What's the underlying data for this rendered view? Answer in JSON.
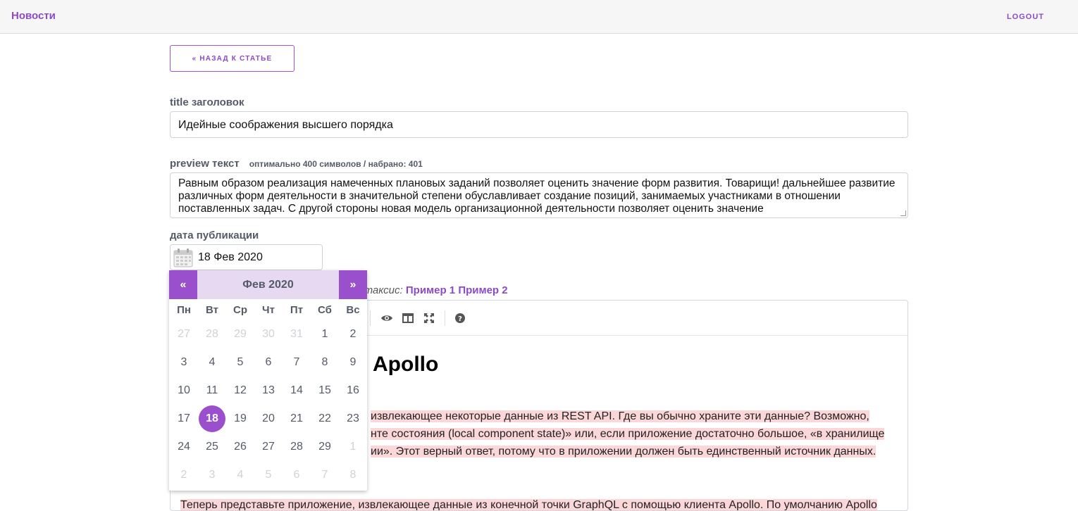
{
  "nav": {
    "brand": "Новости",
    "logout": "LOGOUT"
  },
  "back_button": "« НАЗАД К СТАТЬЕ",
  "title_field": {
    "label": "title заголовок",
    "value": "Идейные соображения высшего порядка"
  },
  "preview_field": {
    "label": "preview текст",
    "counter": "оптимально 400 символов / набрано: 401",
    "value": "Равным образом реализация намеченных плановых заданий позволяет оценить значение форм развития. Товарищи! дальнейшее развитие различных форм деятельности в значительной степени обуславливает создание позиций, занимаемых участниками в отношении поставленных задач. С другой стороны новая модель организационной деятельности позволяет оценить значение"
  },
  "date_field": {
    "label": "дата публикации",
    "value": "18 Фев 2020"
  },
  "syntax_hint": {
    "text": "интаксис:",
    "link1": "Пример 1",
    "link2": "Пример 2"
  },
  "toolbar_icons": [
    "eye-icon",
    "columns-icon",
    "fullscreen-icon",
    "help-icon"
  ],
  "editor": {
    "heading": "Apollo",
    "line1": "извлекающее некоторые данные из REST API. Где вы обычно храните эти данные? Возможно,",
    "line2": "нте состояния (local component state)» или, если приложение достаточно большое, «в хранилище",
    "line3": "ии». Этот верный ответ, потому что в приложении должен быть единственный источник данных.",
    "line4": "Теперь представьте приложение, извлекающее данные из конечной точки GraphQL с помощью клиента Apollo. По умолчанию Apollo"
  },
  "calendar": {
    "prev": "«",
    "next": "»",
    "month": "Фев 2020",
    "weekdays": [
      "Пн",
      "Вт",
      "Ср",
      "Чт",
      "Пт",
      "Сб",
      "Вс"
    ],
    "selected_day": "18",
    "weeks": [
      [
        {
          "d": "27",
          "m": true
        },
        {
          "d": "28",
          "m": true
        },
        {
          "d": "29",
          "m": true
        },
        {
          "d": "30",
          "m": true
        },
        {
          "d": "31",
          "m": true
        },
        {
          "d": "1",
          "m": false
        },
        {
          "d": "2",
          "m": false
        }
      ],
      [
        {
          "d": "3",
          "m": false
        },
        {
          "d": "4",
          "m": false
        },
        {
          "d": "5",
          "m": false
        },
        {
          "d": "6",
          "m": false
        },
        {
          "d": "7",
          "m": false
        },
        {
          "d": "8",
          "m": false
        },
        {
          "d": "9",
          "m": false
        }
      ],
      [
        {
          "d": "10",
          "m": false
        },
        {
          "d": "11",
          "m": false
        },
        {
          "d": "12",
          "m": false
        },
        {
          "d": "13",
          "m": false
        },
        {
          "d": "14",
          "m": false
        },
        {
          "d": "15",
          "m": false
        },
        {
          "d": "16",
          "m": false
        }
      ],
      [
        {
          "d": "17",
          "m": false
        },
        {
          "d": "18",
          "m": false
        },
        {
          "d": "19",
          "m": false
        },
        {
          "d": "20",
          "m": false
        },
        {
          "d": "21",
          "m": false
        },
        {
          "d": "22",
          "m": false
        },
        {
          "d": "23",
          "m": false
        }
      ],
      [
        {
          "d": "24",
          "m": false
        },
        {
          "d": "25",
          "m": false
        },
        {
          "d": "26",
          "m": false
        },
        {
          "d": "27",
          "m": false
        },
        {
          "d": "28",
          "m": false
        },
        {
          "d": "29",
          "m": false
        },
        {
          "d": "1",
          "m": true
        }
      ],
      [
        {
          "d": "2",
          "m": true
        },
        {
          "d": "3",
          "m": true
        },
        {
          "d": "4",
          "m": true
        },
        {
          "d": "5",
          "m": true
        },
        {
          "d": "6",
          "m": true
        },
        {
          "d": "7",
          "m": true
        },
        {
          "d": "8",
          "m": true
        }
      ]
    ]
  },
  "colors": {
    "accent": "#9a4fcd",
    "highlight": "#fcd7d9",
    "calendar_header": "#e8d9f3"
  }
}
